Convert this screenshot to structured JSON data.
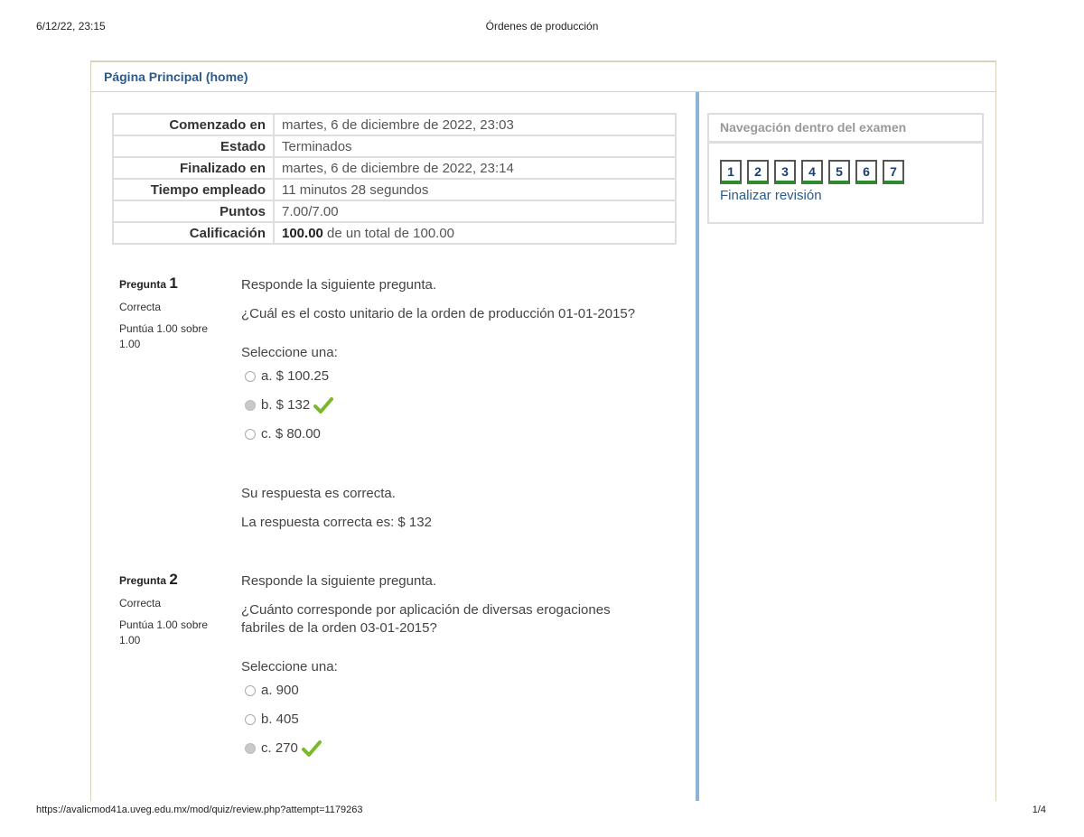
{
  "print_header": {
    "datetime": "6/12/22, 23:15",
    "title": "Órdenes de producción"
  },
  "print_footer": {
    "url": "https://avalicmod41a.uveg.edu.mx/mod/quiz/review.php?attempt=1179263",
    "page": "1/4"
  },
  "breadcrumb": {
    "home": "Página Principal (home)"
  },
  "summary": [
    {
      "label": "Comenzado en",
      "value": "martes, 6 de diciembre de 2022, 23:03"
    },
    {
      "label": "Estado",
      "value": "Terminados"
    },
    {
      "label": "Finalizado en",
      "value": "martes, 6 de diciembre de 2022, 23:14"
    },
    {
      "label": "Tiempo empleado",
      "value": "11 minutos 28 segundos"
    },
    {
      "label": "Puntos",
      "value": "7.00/7.00"
    },
    {
      "label": "Calificación",
      "value_bold": "100.00",
      "value_rest": " de un total de 100.00"
    }
  ],
  "questions": [
    {
      "label": "Pregunta",
      "number": "1",
      "state": "Correcta",
      "grade": "Puntúa 1.00 sobre 1.00",
      "instruction": "Responde la siguiente pregunta.",
      "text": "¿Cuál es el costo unitario de la orden de producción 01-01-2015?",
      "prompt": "Seleccione una:",
      "options": [
        {
          "label": "a. $ 100.25",
          "selected": false,
          "correct": false
        },
        {
          "label": "b. $ 132",
          "selected": true,
          "correct": true
        },
        {
          "label": "c. $ 80.00",
          "selected": false,
          "correct": false
        }
      ],
      "feedback": "Su respuesta es correcta.",
      "right_answer": "La respuesta correcta es: $ 132"
    },
    {
      "label": "Pregunta",
      "number": "2",
      "state": "Correcta",
      "grade": "Puntúa 1.00 sobre 1.00",
      "instruction": "Responde la siguiente pregunta.",
      "text": "¿Cuánto corresponde por aplicación de diversas erogaciones fabriles de la orden 03-01-2015?",
      "prompt": "Seleccione una:",
      "options": [
        {
          "label": "a. 900",
          "selected": false,
          "correct": false
        },
        {
          "label": "b. 405",
          "selected": false,
          "correct": false
        },
        {
          "label": "c. 270",
          "selected": true,
          "correct": true
        }
      ]
    }
  ],
  "nav": {
    "title": "Navegación dentro del examen",
    "buttons": [
      "1",
      "2",
      "3",
      "4",
      "5",
      "6",
      "7"
    ],
    "finish": "Finalizar revisión",
    "status_color": "#2f8a2f"
  },
  "colors": {
    "link": "#2a5b8f",
    "divider": "#8db3d6",
    "check": "#7ab929"
  }
}
